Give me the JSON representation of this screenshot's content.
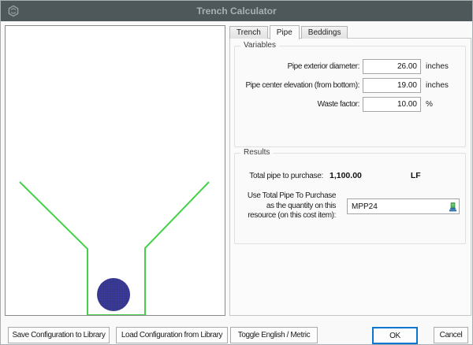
{
  "window": {
    "title": "Trench Calculator"
  },
  "tabs": {
    "items": [
      {
        "label": "Trench"
      },
      {
        "label": "Pipe"
      },
      {
        "label": "Beddings"
      }
    ],
    "active": "Pipe"
  },
  "variables": {
    "group_label": "Variables",
    "fields": [
      {
        "label": "Pipe exterior diameter:",
        "value": "26.00",
        "unit": "inches"
      },
      {
        "label": "Pipe center elevation (from bottom):",
        "value": "19.00",
        "unit": "inches"
      },
      {
        "label": "Waste factor:",
        "value": "10.00",
        "unit": "%"
      }
    ]
  },
  "results": {
    "group_label": "Results",
    "total_label": "Total pipe to purchase:",
    "total_value": "1,100.00",
    "total_unit": "LF",
    "resource_label": "Use Total Pipe To Purchase\nas the quantity on this\nresource (on this cost item):",
    "resource_value": "MPP24"
  },
  "diagram": {
    "trench_color": "#44d04a",
    "pipe_fill": "#3a3a9e",
    "background": "#ffffff"
  },
  "footer": {
    "save_label": "Save Configuration to Library",
    "load_label": "Load Configuration from Library",
    "toggle_label": "Toggle English / Metric",
    "ok_label": "OK",
    "cancel_label": "Cancel"
  }
}
